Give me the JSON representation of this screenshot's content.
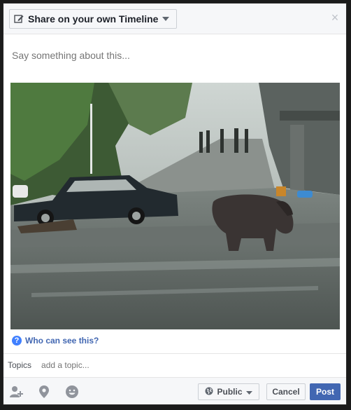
{
  "header": {
    "share_label": "Share on your own Timeline",
    "close_glyph": "×"
  },
  "composer": {
    "placeholder": "Say something about this..."
  },
  "attachment": {
    "image_alt": "Hippopotamus walking on a flooded street beside a parked car"
  },
  "audience": {
    "help_glyph": "?",
    "link_label": "Who can see this?"
  },
  "topics": {
    "label": "Topics",
    "placeholder": "add a topic..."
  },
  "footer": {
    "icons": [
      "tag-people-icon",
      "location-pin-icon",
      "feeling-emoji-icon"
    ],
    "privacy_label": "Public",
    "cancel_label": "Cancel",
    "post_label": "Post"
  },
  "colors": {
    "accent": "#4267b2",
    "link": "#4267b2",
    "help_icon": "#4080ff",
    "header_bg": "#f6f7f9"
  }
}
